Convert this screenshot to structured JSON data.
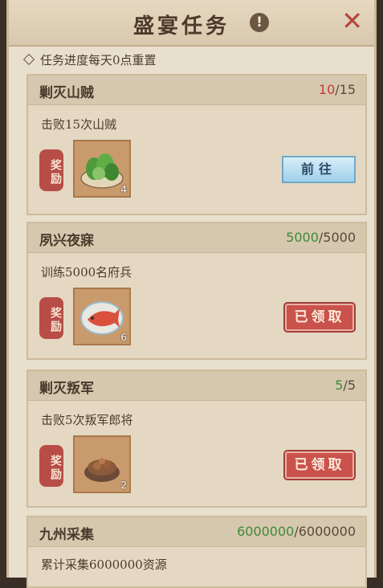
{
  "title": "盛宴任务",
  "info_icon": "!",
  "close_icon": "✕",
  "notice": "任务进度每天0点重置",
  "reward_label": "奖励",
  "tasks": [
    {
      "name": "剿灭山贼",
      "progress_current": "10",
      "progress_total": "15",
      "progress_color": "red",
      "desc": "击败15次山贼",
      "item": "vegetables-icon",
      "item_count": "4",
      "action": "前往",
      "state": "go"
    },
    {
      "name": "夙兴夜寐",
      "progress_current": "5000",
      "progress_total": "5000",
      "progress_color": "green",
      "desc": "训练5000名府兵",
      "item": "fish-plate-icon",
      "item_count": "6",
      "action": "已领取",
      "state": "claimed"
    },
    {
      "name": "剿灭叛军",
      "progress_current": "5",
      "progress_total": "5",
      "progress_color": "green",
      "desc": "击败5次叛军郎将",
      "item": "stew-icon",
      "item_count": "2",
      "action": "已领取",
      "state": "claimed"
    },
    {
      "name": "九州采集",
      "progress_current": "6000000",
      "progress_total": "6000000",
      "progress_color": "green",
      "desc": "累计采集6000000资源"
    }
  ]
}
